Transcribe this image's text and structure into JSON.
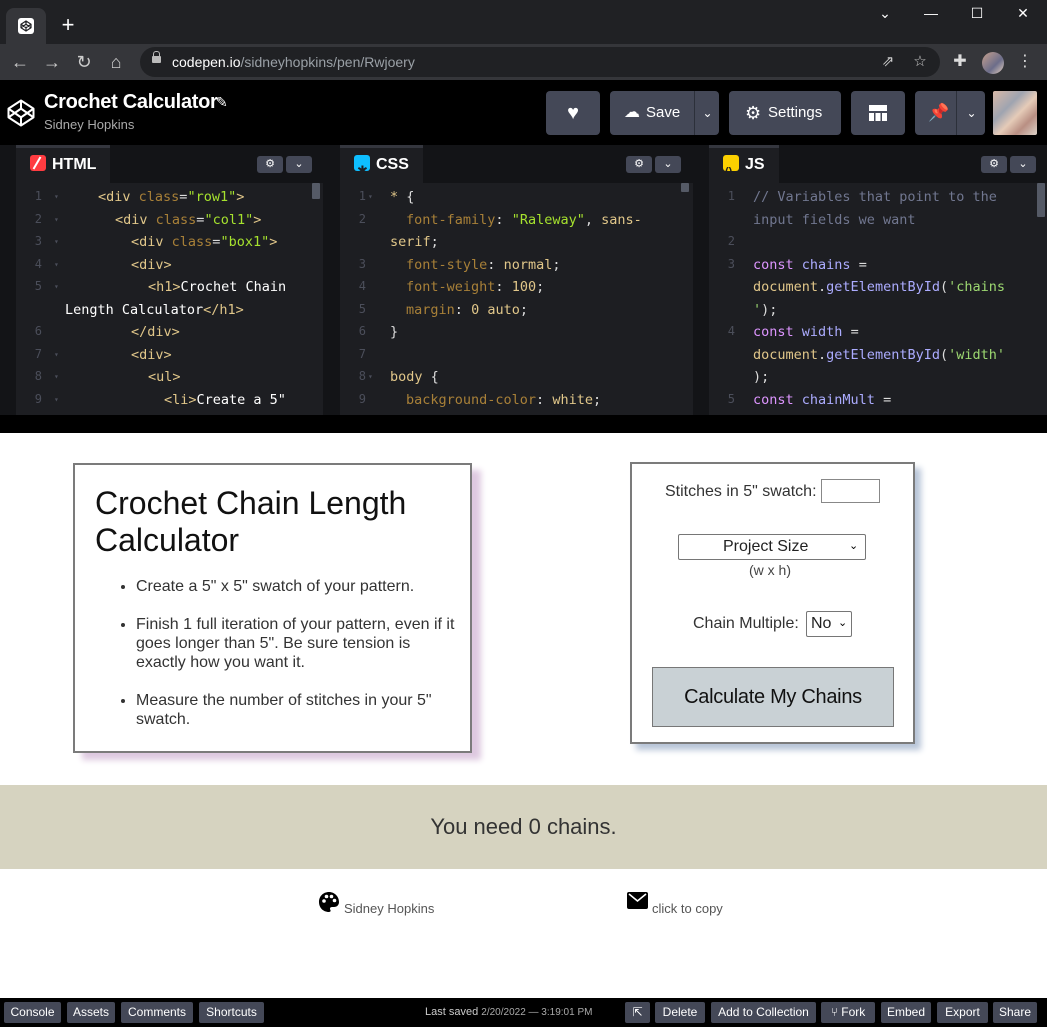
{
  "browser": {
    "new_tab": "+",
    "url_host": "codepen.io",
    "url_path": "/sidneyhopkins/pen/Rwjoery",
    "window": {
      "minimize": "—",
      "maximize": "☐",
      "close": "✕",
      "tablist": "⌄"
    }
  },
  "pen": {
    "title": "Crochet Calculator",
    "author": "Sidney Hopkins",
    "buttons": {
      "save": "Save",
      "settings": "Settings"
    }
  },
  "editors": {
    "html_label": "HTML",
    "css_label": "CSS",
    "js_label": "JS"
  },
  "preview": {
    "heading": "Crochet Chain Length Calculator",
    "steps": [
      "Create a 5\" x 5\" swatch of your pattern.",
      "Finish 1 full iteration of your pattern, even if it goes longer than 5\". Be sure tension is exactly how you want it.",
      "Measure the number of stitches in your 5\" swatch."
    ],
    "stitches_label": "Stitches in 5\" swatch:",
    "stitches_value": "",
    "project_size_select": "Project Size",
    "project_size_hint": "(w x h)",
    "chain_multiple_label": "Chain Multiple:",
    "chain_multiple_value": "No",
    "calculate_button": "Calculate My Chains",
    "result_text": "You need 0 chains.",
    "footer": {
      "author": "Sidney Hopkins",
      "email": "click to copy"
    }
  },
  "bottom_bar": {
    "console": "Console",
    "assets": "Assets",
    "comments": "Comments",
    "shortcuts": "Shortcuts",
    "last_saved_label": "Last saved",
    "last_saved_time": "2/20/2022 — 3:19:01 PM",
    "delete": "Delete",
    "add_to_collection": "Add to Collection",
    "fork": "Fork",
    "embed": "Embed",
    "export": "Export",
    "share": "Share"
  },
  "colors": {
    "codepen_button": "#444857",
    "editor_bg": "#1d1e22",
    "html_icon": "#ff3c41",
    "css_icon": "#0ebeff",
    "js_icon": "#fcd000",
    "result_band": "#d6d3c0",
    "calc_button": "#c9d1d5"
  }
}
